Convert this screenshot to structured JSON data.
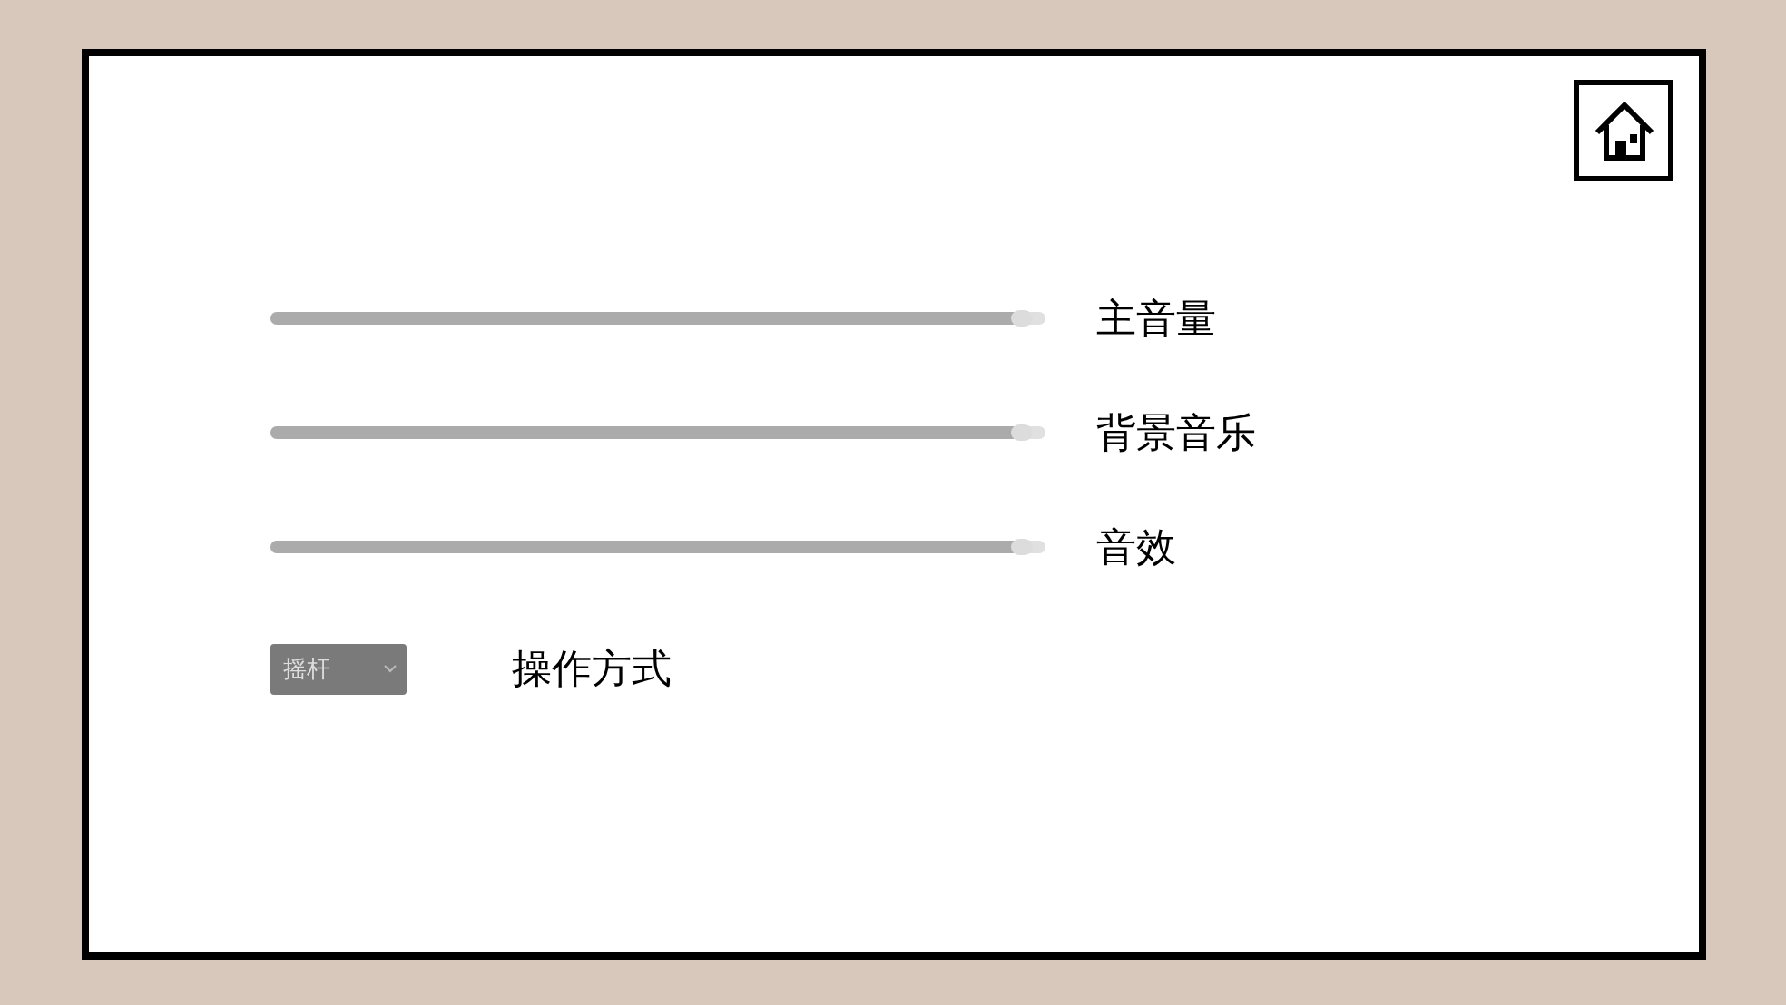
{
  "sliders": [
    {
      "label": "主音量",
      "level": 0.97
    },
    {
      "label": "背景音乐",
      "level": 0.97
    },
    {
      "label": "音效",
      "level": 0.97
    }
  ],
  "control": {
    "value": "摇杆",
    "label": "操作方式"
  }
}
